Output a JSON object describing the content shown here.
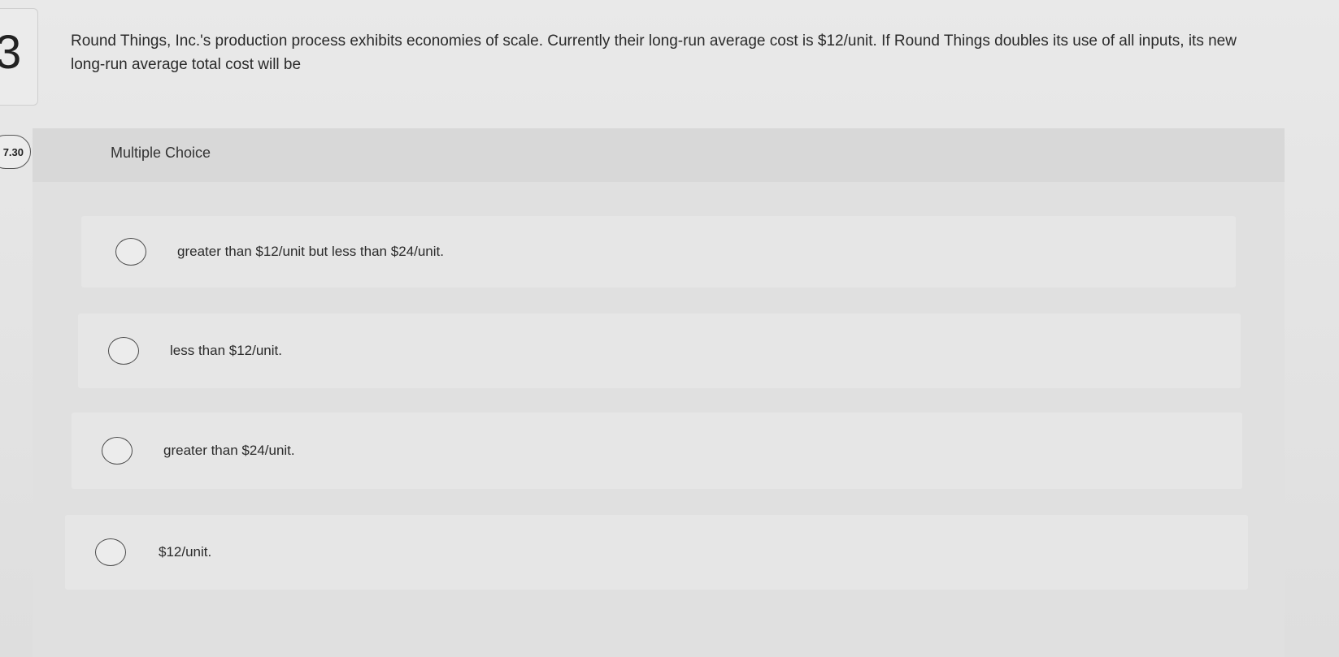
{
  "question": {
    "number": "3",
    "points": "7.30",
    "text": "Round Things, Inc.'s production process exhibits economies of scale. Currently their long-run average cost is $12/unit. If Round Things doubles its use of all inputs, its new long-run average total cost will be"
  },
  "choices": {
    "title": "Multiple Choice",
    "options": [
      {
        "label": "greater than $12/unit but less than $24/unit."
      },
      {
        "label": "less than $12/unit."
      },
      {
        "label": "greater than $24/unit."
      },
      {
        "label": "$12/unit."
      }
    ]
  },
  "colors": {
    "background": "#e6e6e6",
    "panel": "#e0e0e0",
    "header": "#d8d8d8",
    "text": "#2a2a2a"
  }
}
